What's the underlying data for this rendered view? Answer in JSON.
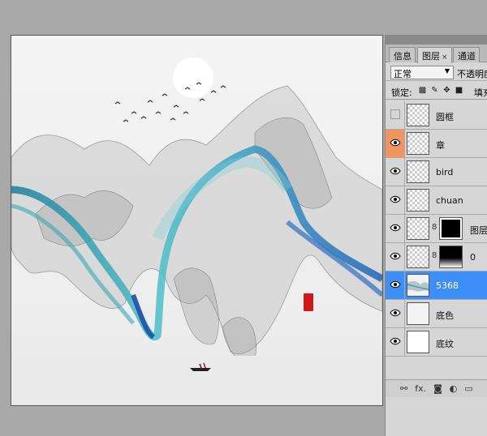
{
  "panel": {
    "tabs": [
      {
        "label": "信息"
      },
      {
        "label": "图层",
        "close": "×"
      },
      {
        "label": "通道"
      }
    ],
    "blend_mode": "正常",
    "opacity_label": "不透明度",
    "lock_label": "锁定:",
    "fill_label": "填充",
    "icons": [
      "lock-transparent-icon",
      "lock-paint-icon",
      "lock-move-icon",
      "lock-all-icon"
    ],
    "footer_icons": [
      "link-icon",
      "fx-icon",
      "mask-icon",
      "adjustment-icon",
      "group-icon"
    ],
    "footer_fx": "fx."
  },
  "layers": [
    {
      "name": "圆框",
      "visible": false
    },
    {
      "name": "章",
      "visible": true,
      "highlight": true
    },
    {
      "name": "bird",
      "visible": true
    },
    {
      "name": "chuan",
      "visible": true
    },
    {
      "name": "图层",
      "visible": true,
      "has_mask": true
    },
    {
      "name": "0",
      "visible": true,
      "has_mask": true
    },
    {
      "name": "5368",
      "visible": true,
      "selected": true
    },
    {
      "name": "底色",
      "visible": true
    },
    {
      "name": "底纹",
      "visible": true
    }
  ],
  "colors": {
    "selected_layer": "#3e8ef7",
    "highlight_eye": "#f2955f",
    "ink_teal": "#2a9aa8",
    "ink_blue": "#1f64b8",
    "seal_red": "#d01818"
  }
}
